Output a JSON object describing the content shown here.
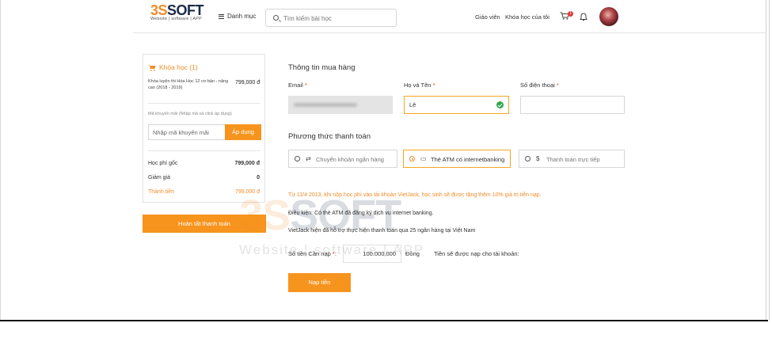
{
  "header": {
    "logo": {
      "brand_a": "3S",
      "brand_b": "SOFT",
      "tagline": "Website | software | APP"
    },
    "menu_label": "Danh mục",
    "search_placeholder": "Tìm kiếm bài học",
    "nav": {
      "teacher": "Giáo viên",
      "my_courses": "Khóa học của tôi"
    },
    "cart_count": "1"
  },
  "order": {
    "title": "Khóa học (1)",
    "course_name": "Khóa luyện thi Hóa Học 12 cơ bản - nâng cao (2018 - 2019)",
    "course_price": "799,000 đ",
    "promo_hint": "Mã khuyến mãi (Nhập mã và click áp dụng)",
    "promo_placeholder": "Nhập mã khuyến mãi",
    "promo_button": "Áp dụng",
    "summary": {
      "original_label": "Học phí gốc",
      "original_value": "799,000 đ",
      "discount_label": "Giảm giá",
      "discount_value": "0",
      "total_label": "Thành tiền",
      "total_value": "799,000 đ"
    },
    "finish_button": "Hoàn tất thanh toán"
  },
  "purchase": {
    "section_title": "Thông tin mua hàng",
    "email_label": "Email",
    "name_label": "Họ và Tên",
    "name_value": "Lê",
    "phone_label": "Số điện thoại",
    "required_mark": "*"
  },
  "payment": {
    "section_title": "Phương thức thanh toán",
    "options": [
      {
        "label": "Chuyển khoản ngân hàng",
        "icon": "⇄",
        "selected": false
      },
      {
        "label": "Thẻ ATM có internetbanking",
        "icon": "▭",
        "selected": true
      },
      {
        "label": "Thanh toán trực tiếp",
        "icon": "$",
        "selected": false
      }
    ],
    "promo_note": "Từ 11/4 2013, khi nộp học phí vào tài khoản VietJack, học sinh sẽ được tặng thêm 10% giá trị tiền nạp.",
    "condition": "Điều kiện: Có thẻ ATM đã đăng ký dịch vụ internet banking.",
    "support_note": "VietJack hiện đã hỗ trợ thực hiện thanh toán qua 25 ngân hàng tại Việt Nam",
    "amount_label": "Số tiền Cần nạp",
    "amount_value": "100.000.000",
    "amount_unit": "Đồng",
    "account_label": "Tiền sẽ được nạp cho tài khoản:",
    "topup_button": "Nạp tiền"
  },
  "watermark": {
    "brand_a": "3S",
    "brand_b": "SOFT",
    "tagline": "Website | software | APP"
  },
  "colors": {
    "accent": "#f7941d",
    "brand_dark": "#1b2a4a",
    "success": "#2eaa4a",
    "required": "#e53935"
  }
}
